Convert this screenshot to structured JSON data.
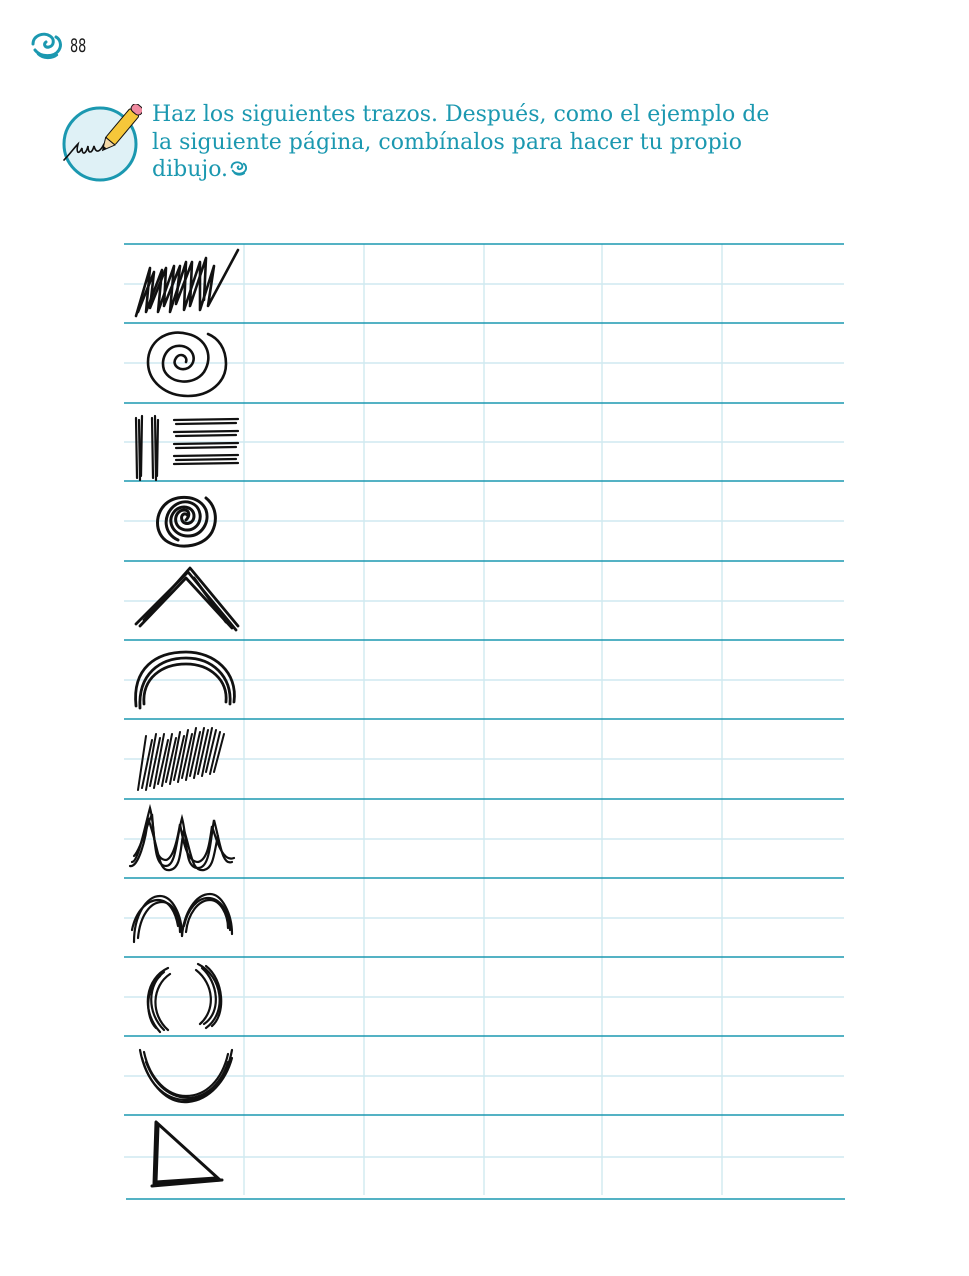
{
  "page": {
    "number": "88"
  },
  "instruction": {
    "lines": [
      "Haz los siguientes trazos. Después, como el ejemplo de",
      "la siguiente página, combínalos para hacer tu propio",
      "dibujo."
    ]
  },
  "colors": {
    "accent": "#1b98b0",
    "grid_major": "#1b98b0",
    "grid_minor": "#cfe9f0",
    "icon_circle_fill": "#dff1f6",
    "pencil_yellow": "#f6c73a",
    "pencil_pink": "#f08aa0",
    "ink": "#111111"
  },
  "icons": {
    "page_marker": "swirl-icon",
    "instruction": "pencil-writing-icon",
    "end_marker": "swirl-icon"
  },
  "practice_grid": {
    "columns": 6,
    "rows": [
      {
        "stroke": "zigzag-scribble"
      },
      {
        "stroke": "spiral"
      },
      {
        "stroke": "vertical-and-horizontal-lines"
      },
      {
        "stroke": "dense-spiral"
      },
      {
        "stroke": "inverted-v"
      },
      {
        "stroke": "arch"
      },
      {
        "stroke": "diagonal-hatching"
      },
      {
        "stroke": "connected-loops-down"
      },
      {
        "stroke": "double-arches"
      },
      {
        "stroke": "parentheses-curves"
      },
      {
        "stroke": "u-curve"
      },
      {
        "stroke": "triangle"
      }
    ]
  }
}
